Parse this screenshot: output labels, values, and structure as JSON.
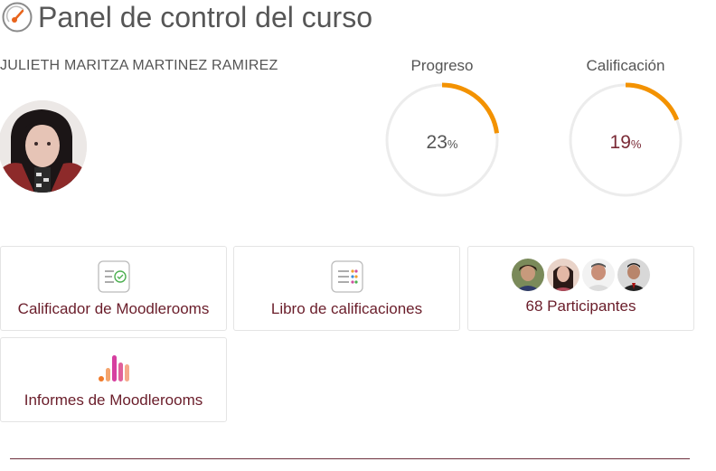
{
  "header": {
    "title": "Panel de control del curso",
    "icon": "dashboard-icon"
  },
  "user": {
    "name": "JULIETH MARITZA MARTINEZ RAMIREZ",
    "avatar_icon": "user-avatar"
  },
  "gauges": {
    "progress": {
      "label": "Progreso",
      "value": "23",
      "unit": "%",
      "fraction": 0.23
    },
    "grade": {
      "label": "Calificación",
      "value": "19",
      "unit": "%",
      "fraction": 0.19
    }
  },
  "tiles": {
    "grader": {
      "label": "Calificador de Moodlerooms",
      "icon": "grader-check-icon"
    },
    "gradebook": {
      "label": "Libro de calificaciones",
      "icon": "gradebook-list-icon"
    },
    "participants": {
      "label": "68 Participantes",
      "icon": "participant-avatars"
    },
    "reports": {
      "label": "Informes de Moodlerooms",
      "icon": "bar-chart-icon"
    }
  },
  "colors": {
    "accent": "#f39200",
    "track": "#ececec",
    "link": "#6a1d2a",
    "rule": "#6d2f3d",
    "progress_text": "#555555",
    "grade_text": "#7a2a36"
  }
}
